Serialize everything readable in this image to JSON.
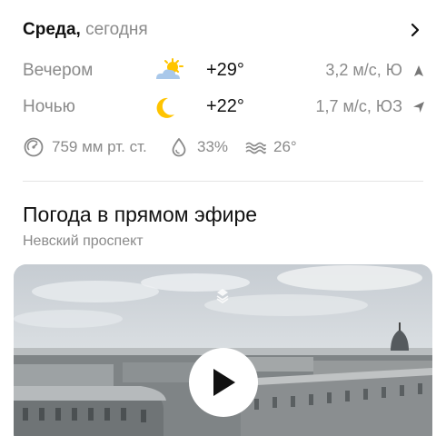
{
  "day": {
    "name": "Среда,",
    "sub": " сегодня"
  },
  "forecast": [
    {
      "label": "Вечером",
      "icon": "sun-cloud-icon",
      "temp": "+29°",
      "wind": "3,2 м/с, Ю",
      "wind_icon": "wind-arrow-north-icon"
    },
    {
      "label": "Ночью",
      "icon": "moon-icon",
      "temp": "+22°",
      "wind": "1,7 м/с, ЮЗ",
      "wind_icon": "wind-arrow-northeast-icon"
    }
  ],
  "params": {
    "pressure": "759 мм рт. ст.",
    "humidity": "33%",
    "water_temp": "26°"
  },
  "live": {
    "title": "Погода в прямом эфире",
    "location": "Невский проспект"
  },
  "colors": {
    "text": "#111111",
    "muted": "#8a8a8a",
    "sun": "#ffc400",
    "cloud": "#a9c8ea"
  }
}
